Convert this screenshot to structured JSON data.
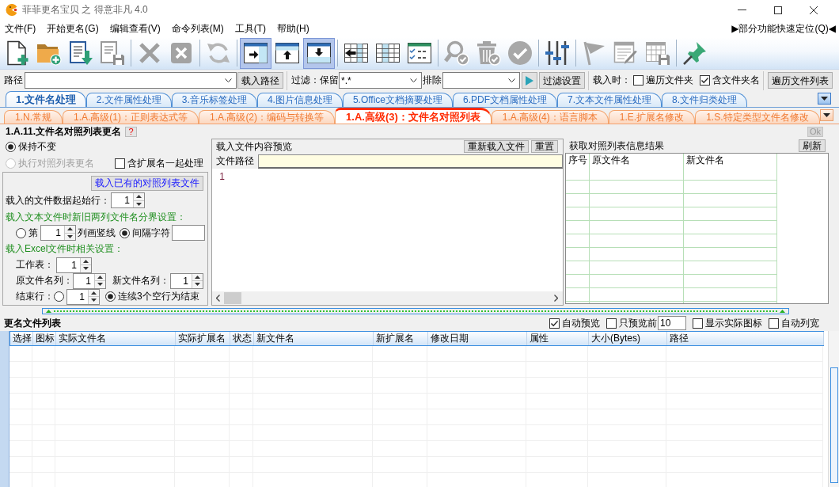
{
  "window": {
    "title": "菲菲更名宝贝 之 得意非凡 4.0"
  },
  "menu": {
    "items": [
      "文件(F)",
      "开始更名(G)",
      "编辑查看(V)",
      "命令列表(M)",
      "工具(T)",
      "帮助(H)"
    ],
    "quick_locate": "▶部分功能快速定位(Q)◀"
  },
  "toolbar": {
    "groups": [
      {
        "buttons": [
          {
            "disabled": false
          },
          {
            "disabled": false
          },
          {
            "disabled": false
          },
          {
            "disabled": true
          }
        ]
      },
      {
        "buttons": [
          {
            "disabled": true
          },
          {
            "disabled": true
          }
        ]
      },
      {
        "buttons": [
          {
            "disabled": true
          }
        ]
      },
      {
        "buttons": [
          {
            "disabled": false,
            "selected": true
          },
          {
            "disabled": false,
            "selected": false
          },
          {
            "disabled": false,
            "selected": true
          }
        ]
      },
      {
        "buttons": [
          {
            "disabled": false
          },
          {
            "disabled": false
          },
          {
            "disabled": false
          }
        ]
      },
      {
        "buttons": [
          {
            "disabled": true
          },
          {
            "disabled": true
          },
          {
            "disabled": true
          }
        ]
      },
      {
        "buttons": [
          {
            "disabled": false
          }
        ]
      },
      {
        "buttons": [
          {
            "disabled": true
          },
          {
            "disabled": true
          },
          {
            "disabled": true
          }
        ]
      },
      {
        "buttons": [
          {
            "disabled": false
          }
        ]
      }
    ]
  },
  "path_bar": {
    "label": "路径",
    "load_button": "载入路径",
    "filter_label": "过滤：保留",
    "keep_value": "*.*",
    "exclude_label": "排除",
    "filter_settings_button": "过滤设置",
    "load_when_label": "载入时：",
    "load_options": [
      {
        "label": "遍历文件夹",
        "checked": false
      },
      {
        "label": "含文件夹名",
        "checked": true
      }
    ],
    "traverse_button": "遍历文件列表"
  },
  "main_tabs": [
    {
      "label": "1.文件名处理",
      "selected": true
    },
    {
      "label": "2.文件属性处理",
      "selected": false
    },
    {
      "label": "3.音乐标签处理",
      "selected": false
    },
    {
      "label": "4.图片信息处理",
      "selected": false
    },
    {
      "label": "5.Office文档摘要处理",
      "selected": false
    },
    {
      "label": "6.PDF文档属性处理",
      "selected": false
    },
    {
      "label": "7.文本文件属性处理",
      "selected": false
    },
    {
      "label": "8.文件归类处理",
      "selected": false
    }
  ],
  "sub_tabs": [
    {
      "label": "1.N.常规",
      "selected": false
    },
    {
      "label": "1.A.高级(1)：正则表达式等",
      "selected": false
    },
    {
      "label": "1.A.高级(2)：编码与转换等",
      "selected": false
    },
    {
      "label": "1.A.高级(3)：文件名对照列表",
      "selected": true
    },
    {
      "label": "1.A.高级(4)：语言脚本",
      "selected": false
    },
    {
      "label": "1.E.扩展名修改",
      "selected": false
    },
    {
      "label": "1.S.特定类型文件名修改",
      "selected": false
    }
  ],
  "section": {
    "title": "1.A.11.文件名对照列表更名",
    "help_button": "?",
    "ok_button": {
      "label": "Ok",
      "disabled": true
    }
  },
  "mapping_panel": {
    "mode_options": [
      {
        "label": "保持不变",
        "selected": true,
        "disabled": false
      },
      {
        "label": "执行对照列表更名",
        "selected": false,
        "disabled": true
      }
    ],
    "include_extension": {
      "label": "含扩展名一起处理",
      "checked": false
    },
    "load_list_button": "载入已有的对照列表文件",
    "start_row": {
      "label": "载入的文件数据起始行：",
      "value": "1"
    },
    "text_file_heading": "载入文本文件时新旧两列文件名分界设置：",
    "split_options": [
      {
        "kind": "column",
        "label": "第",
        "value": "1",
        "suffix": "列画竖线",
        "selected": false
      },
      {
        "kind": "separator",
        "label": "间隔字符",
        "selected": true
      }
    ],
    "excel_heading": "载入Excel文件时相关设置：",
    "sheet": {
      "label": "工作表：",
      "value": "1"
    },
    "old_name_column": {
      "label": "原文件名列：",
      "value": "1"
    },
    "new_name_column": {
      "label": "新文件名列：",
      "value": "1"
    },
    "end_row": {
      "label": "结束行：",
      "options": [
        {
          "kind": "row",
          "value": "1",
          "selected": false
        },
        {
          "kind": "blank-lines",
          "label": "连续3个空行为结束",
          "selected": true
        }
      ]
    }
  },
  "preview": {
    "title": "载入文件内容预览",
    "reload_button": "重新载入文件",
    "reset_button": "重置",
    "path_label": "文件路径",
    "line_numbers": [
      "1"
    ]
  },
  "result": {
    "title": "获取对照列表信息结果",
    "refresh_button": "刷新",
    "columns": [
      "序号",
      "原文件名",
      "新文件名"
    ]
  },
  "file_list": {
    "title": "更名文件列表",
    "options": [
      {
        "label": "自动预览",
        "checked": true
      },
      {
        "label": "只预览前",
        "checked": false,
        "value": "10"
      },
      {
        "label": "显示实际图标",
        "checked": false
      },
      {
        "label": "自动列宽",
        "checked": false
      }
    ],
    "columns": [
      "选择",
      "图标",
      "实际文件名",
      "实际扩展名",
      "状态",
      "新文件名",
      "新扩展名",
      "修改日期",
      "属性",
      "大小(Bytes)",
      "路径"
    ]
  }
}
